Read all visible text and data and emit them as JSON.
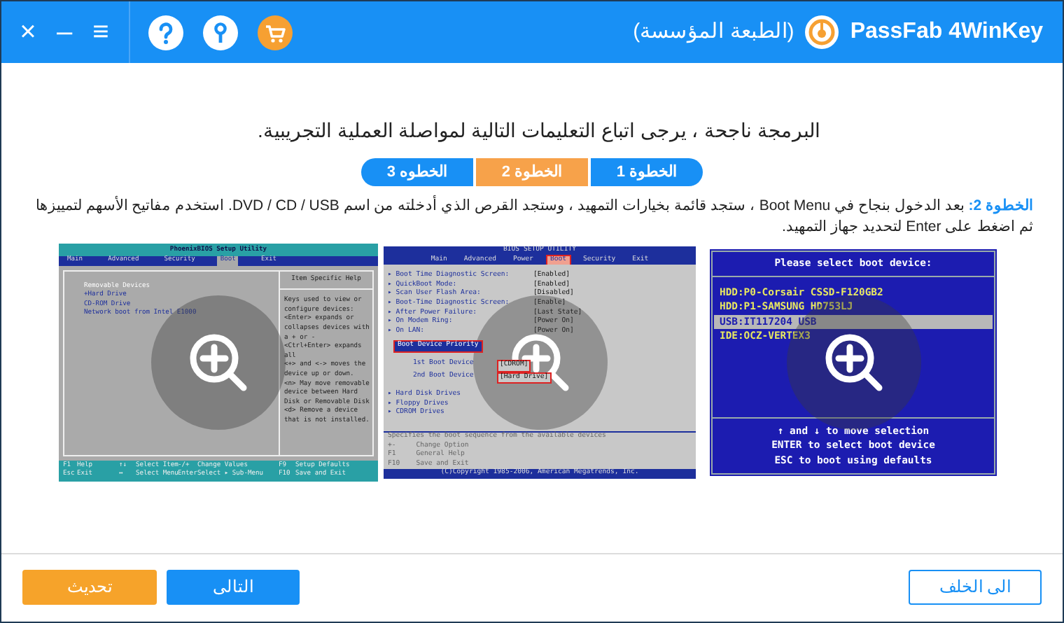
{
  "window": {
    "title": "PassFab 4WinKey",
    "edition": "(الطبعة المؤسسة)"
  },
  "window_controls": [
    "×",
    "–",
    "≡"
  ],
  "instruction": "البرمجة ناجحة ، يرجى اتباع التعليمات التالية لمواصلة العملية التجريبية.",
  "steps": [
    {
      "label": "الخطوة 1",
      "selected": false
    },
    {
      "label": "الخطوة 2",
      "selected": true
    },
    {
      "label": "الخطوه 3",
      "selected": false
    }
  ],
  "description": {
    "label": "الخطوة 2:",
    "text": " بعد الدخول بنجاح في Boot Menu ، ستجد قائمة بخيارات التمهيد ، وستجد القرص الذي أدخلته من اسم DVD / CD / USB. استخدم مفاتيح الأسهم لتمييزها ثم اضغط على Enter لتحديد جهاز التمهيد."
  },
  "screenshots": [
    {
      "kind": "phoenix",
      "title": "PhoenixBIOS Setup Utility",
      "menu": [
        {
          "label": "Main",
          "selected": false
        },
        {
          "label": "Advanced",
          "selected": false
        },
        {
          "label": "Security",
          "selected": false
        },
        {
          "label": "Boot",
          "selected": true
        },
        {
          "label": "Exit",
          "selected": false
        }
      ],
      "items": [
        "Removable Devices",
        "+Hard Drive",
        "CD-ROM Drive",
        "Network boot from Intel E1000"
      ],
      "help_title": "Item Specific Help",
      "help_lines": [
        "Keys used to view or",
        "configure devices:",
        "<Enter> expands or",
        "collapses devices with",
        "a + or -",
        "<Ctrl+Enter> expands",
        "all",
        "<+> and <-> moves the",
        "device up or down.",
        "<n> May move removable",
        "device between Hard",
        "Disk or Removable Disk",
        "<d> Remove a device",
        "that is not installed."
      ],
      "footer": [
        [
          "F1",
          "Help",
          "↑↓",
          "Select Item",
          "-/+",
          "Change Values",
          "F9",
          "Setup Defaults"
        ],
        [
          "Esc",
          "Exit",
          "↔",
          "Select Menu",
          "Enter",
          "Select ▸ Sub-Menu",
          "F10",
          "Save and Exit"
        ]
      ]
    },
    {
      "kind": "ami",
      "title": "BIOS SETUP UTILITY",
      "menu": [
        {
          "label": "Main",
          "selected": false
        },
        {
          "label": "Advanced",
          "selected": false
        },
        {
          "label": "Power",
          "selected": false
        },
        {
          "label": "Boot",
          "selected": true
        },
        {
          "label": "Security",
          "selected": false
        },
        {
          "label": "Exit",
          "selected": false
        }
      ],
      "settings": [
        {
          "label": "▸ Boot Time Diagnostic Screen:",
          "value": "[Enabled]"
        },
        {
          "label": "▸ QuickBoot Mode:",
          "value": "[Enabled]"
        },
        {
          "label": "▸ Scan User Flash Area:",
          "value": "[Disabled]"
        },
        {
          "label": "▸ Boot-Time Diagnostic Screen:",
          "value": "[Enable]"
        },
        {
          "label": "▸ After Power Failure:",
          "value": "[Last State]"
        },
        {
          "label": "▸ On Modem Ring:",
          "value": "[Power On]"
        },
        {
          "label": "▸ On LAN:",
          "value": "[Power On]"
        }
      ],
      "priority": "Boot Device Priority",
      "devices": [
        {
          "label": "1st Boot Device",
          "value": "[CDROM]"
        },
        {
          "label": "2nd Boot Device",
          "value": "[Hard Drive]"
        }
      ],
      "drives": [
        "▸ Hard Disk Drives",
        "▸ Floppy Drives",
        "▸ CDROM Drives"
      ],
      "help_lines": [
        "Specifies the boot sequence from the available devices",
        "+-     Change Option",
        "F1     General Help",
        "F10    Save and Exit"
      ],
      "copyright": "(C)Copyright 1985-2006, American Megatrends, Inc."
    },
    {
      "kind": "bootmenu",
      "title": "Please select boot device:",
      "devices": [
        {
          "label": "HDD:P0-Corsair CSSD-F120GB2",
          "selected": false
        },
        {
          "label": "HDD:P1-SAMSUNG HD753LJ",
          "selected": false
        },
        {
          "label": "USB:IT117204 USB",
          "selected": true
        },
        {
          "label": "IDE:OCZ-VERTEX3",
          "selected": false
        }
      ],
      "help_lines": [
        "↑ and ↓ to move selection",
        "ENTER to select boot device",
        "ESC to boot using defaults"
      ]
    }
  ],
  "buttons": {
    "back": "الى الخلف",
    "next": "التالى",
    "refresh": "تحديث"
  }
}
